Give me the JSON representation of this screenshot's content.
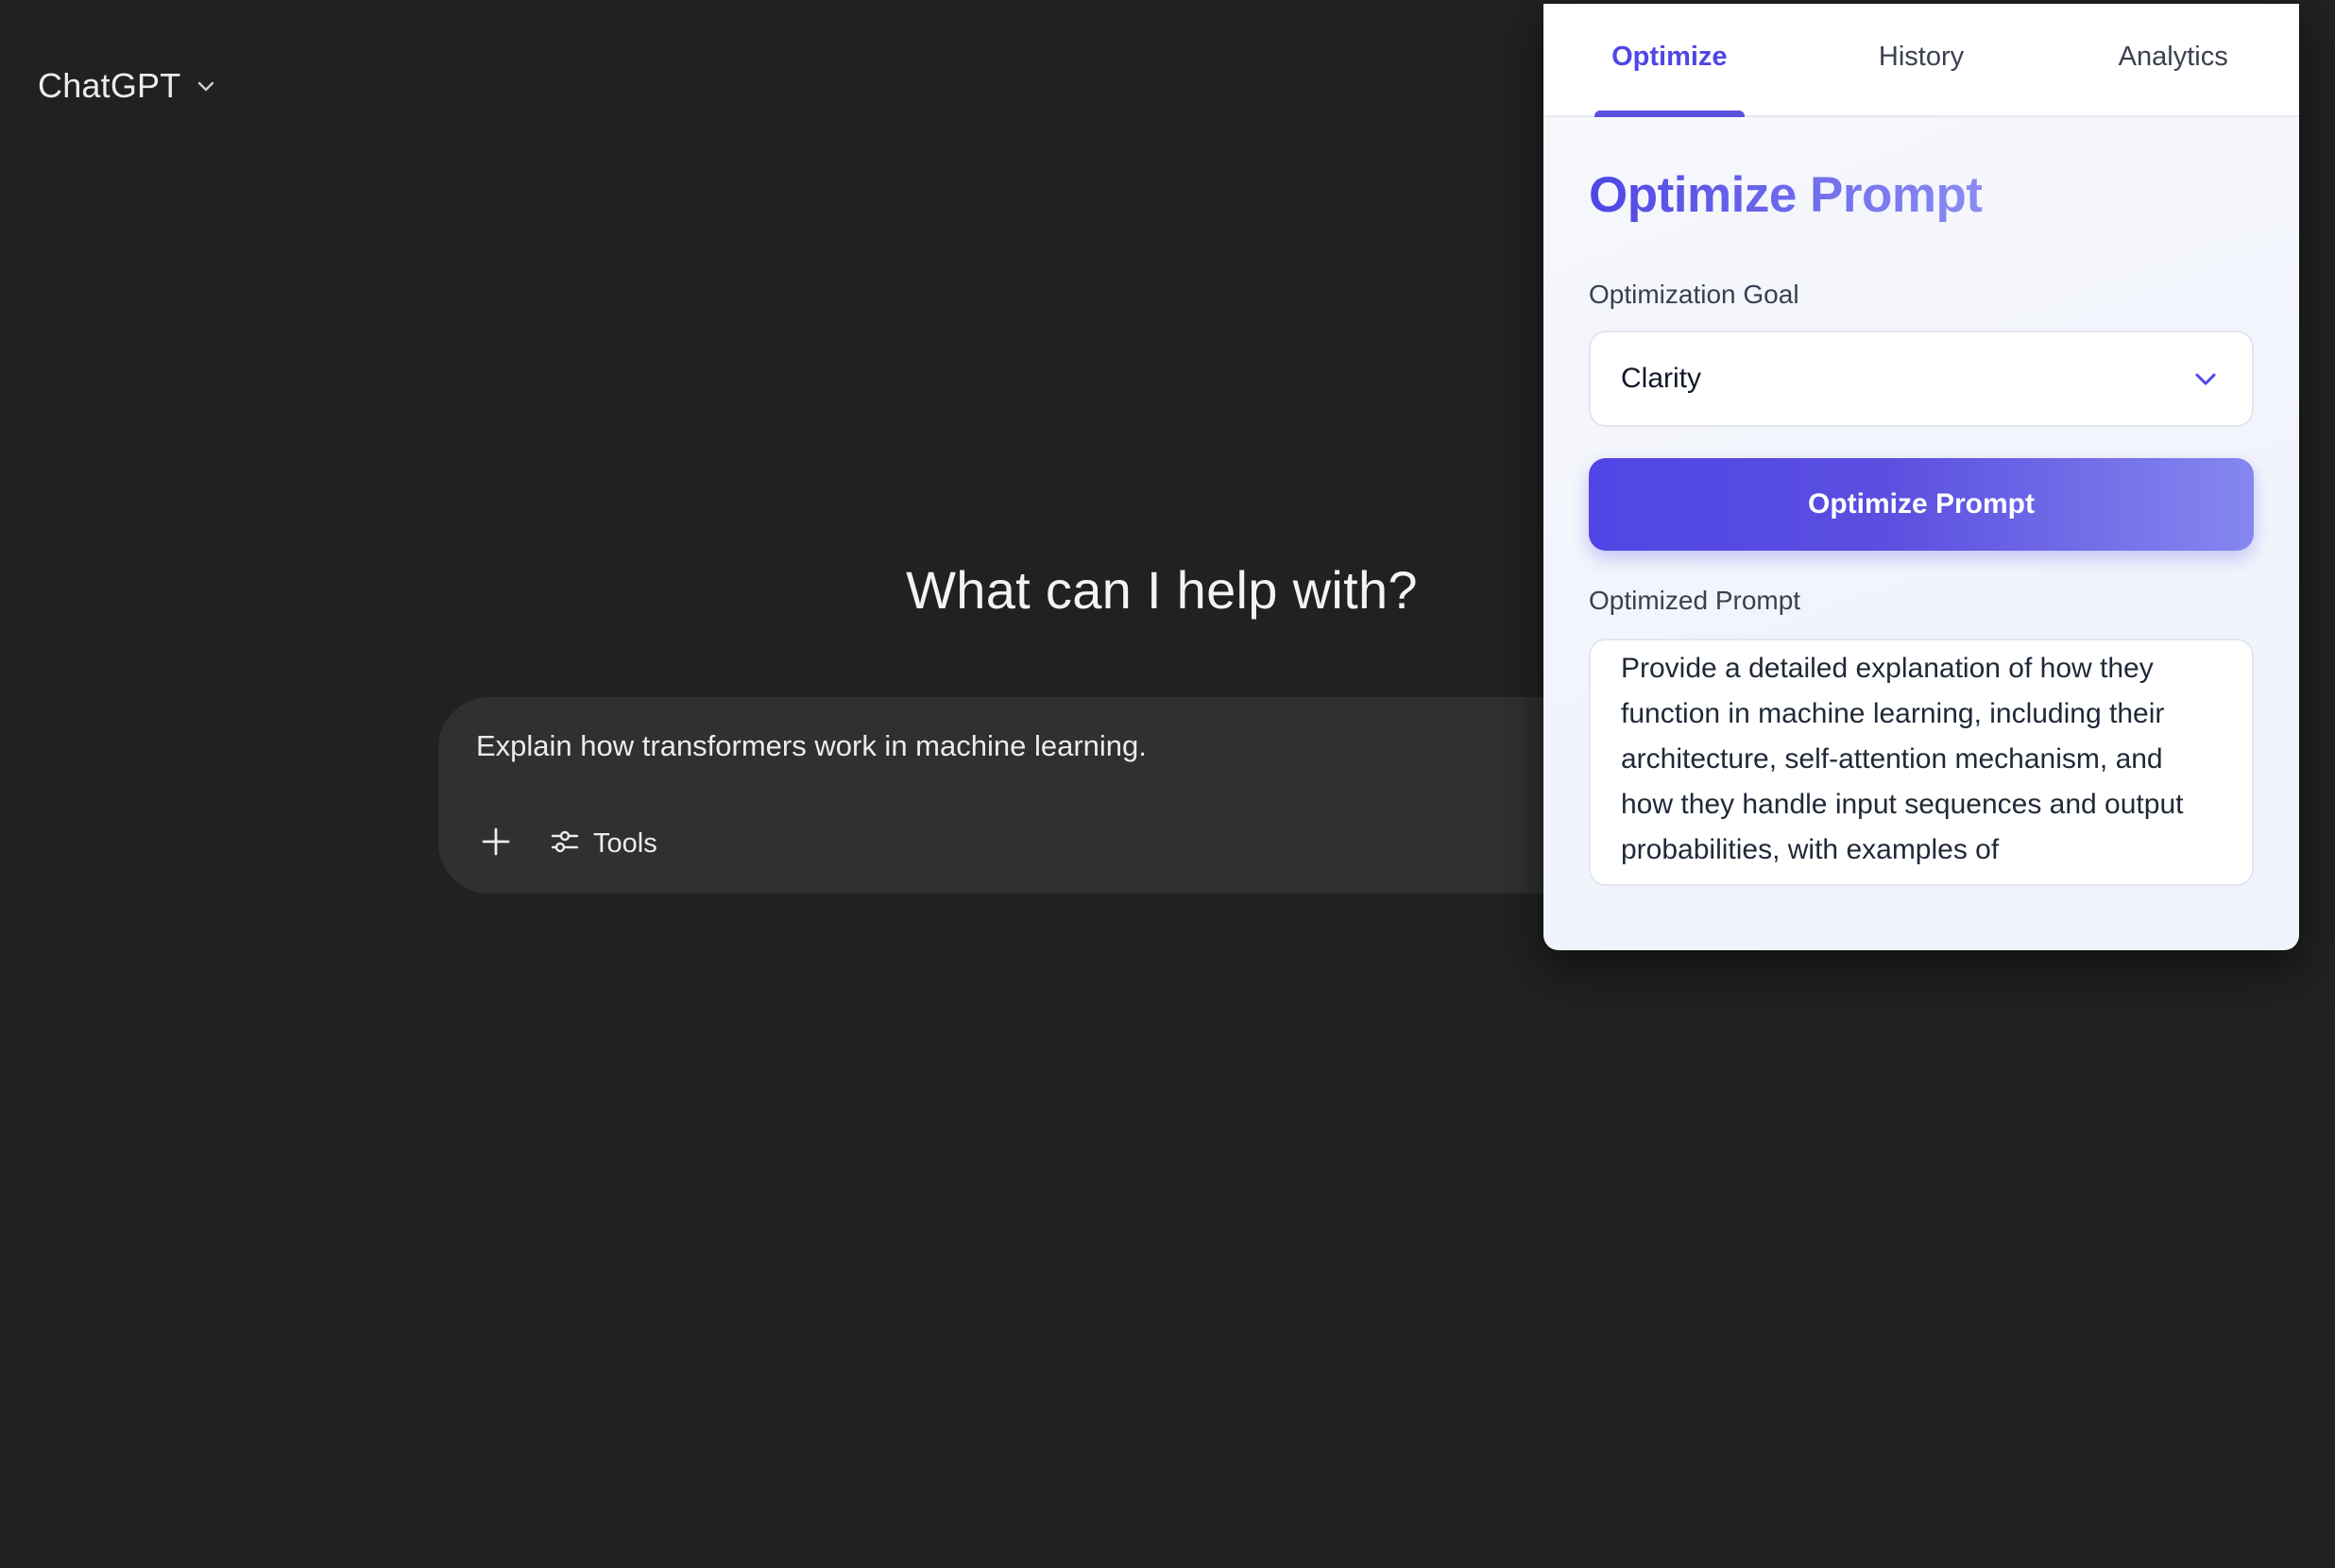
{
  "app": {
    "model_name": "ChatGPT",
    "hero_text": "What can I help with?",
    "composer": {
      "input_value": "Explain how transformers work in machine learning.",
      "tools_label": "Tools"
    }
  },
  "extension": {
    "tabs": [
      {
        "label": "Optimize",
        "active": true
      },
      {
        "label": "History",
        "active": false
      },
      {
        "label": "Analytics",
        "active": false
      }
    ],
    "title": "Optimize Prompt",
    "goal_label": "Optimization Goal",
    "goal_value": "Clarity",
    "button_label": "Optimize Prompt",
    "result_label": "Optimized Prompt",
    "result_text": "Provide a detailed explanation of how they function in machine learning, including their architecture, self-attention mechanism, and how they handle input sequences and output probabilities, with examples of",
    "accent_color": "#4f46e5"
  },
  "icons": {
    "model_chevron": "chevron-down-icon",
    "plus": "plus-icon",
    "tools": "sliders-icon",
    "select_chevron": "chevron-down-icon"
  }
}
